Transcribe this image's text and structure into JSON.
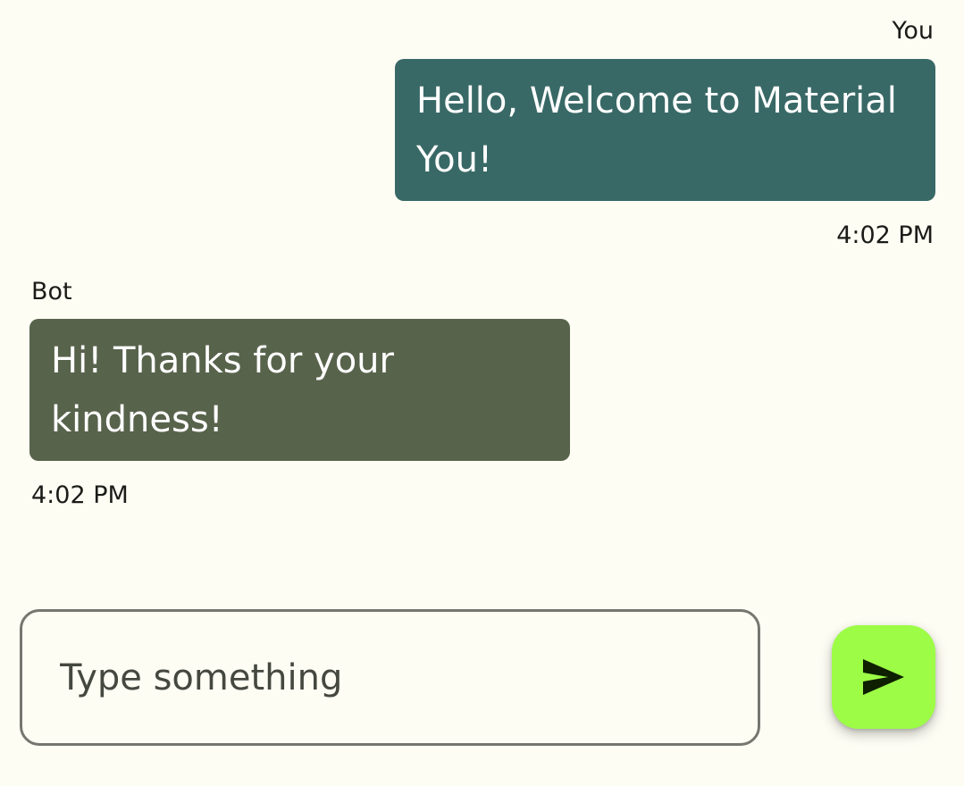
{
  "messages": [
    {
      "sender": "You",
      "text": "Hello, Welcome to Material You!",
      "time": "4:02 PM",
      "color": "#396966"
    },
    {
      "sender": "Bot",
      "text": "Hi! Thanks for your kindness!",
      "time": "4:02 PM",
      "color": "#58634c"
    }
  ],
  "composer": {
    "placeholder": "Type something",
    "value": "",
    "send_icon": "send-icon",
    "send_color": "#9dfd46"
  }
}
